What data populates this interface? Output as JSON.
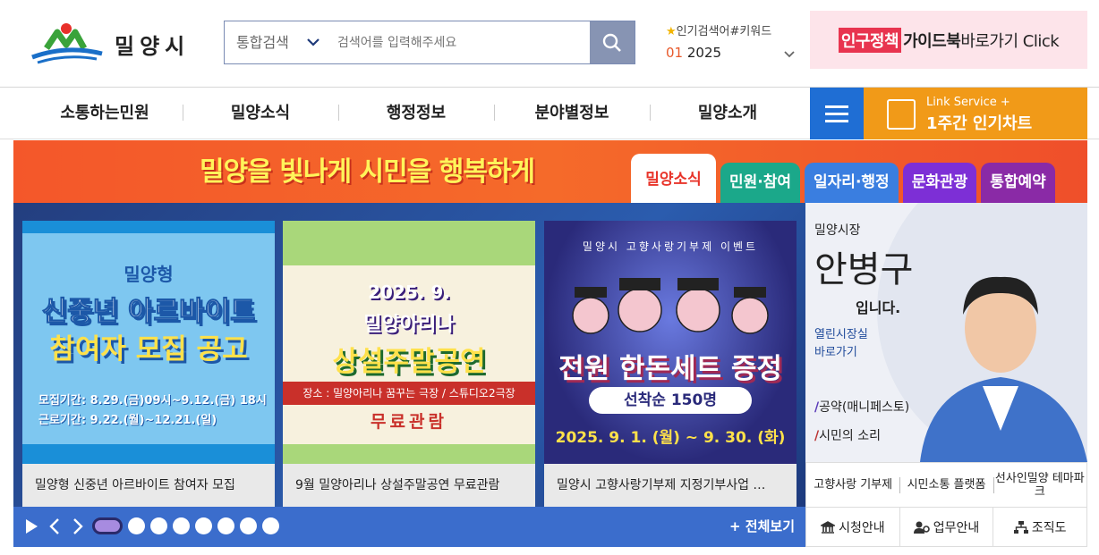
{
  "header": {
    "logo_text": "밀양시",
    "search": {
      "category": "통합검색",
      "placeholder": "검색어를 입력해주세요",
      "value": ""
    },
    "popular": {
      "title": "인기검색어#키워드",
      "rank": "01",
      "keyword": "2025"
    },
    "guide_banner": {
      "highlight": "인구정책",
      "bold": "가이드북",
      "rest": "바로가기 Click"
    }
  },
  "nav": {
    "items": [
      "소통하는민원",
      "밀양소식",
      "행정정보",
      "분야별정보",
      "밀양소개"
    ],
    "link_service": {
      "line1": "Link Service +",
      "line2": "1주간 인기차트"
    }
  },
  "band": {
    "slogan": "밀양을 빛나게 시민을 행복하게"
  },
  "tabs": [
    {
      "label": "밀양소식",
      "color": "#ffffff"
    },
    {
      "label": "민원·참여",
      "color": "#1ba88a"
    },
    {
      "label": "일자리·행정",
      "color": "#3a7ee0"
    },
    {
      "label": "문화관광",
      "color": "#7d2fd6"
    },
    {
      "label": "통합예약",
      "color": "#8a2aa6"
    }
  ],
  "cards": [
    {
      "caption": "밀양형 신중년 아르바이트 참여자 모집",
      "lines": [
        "밀양형",
        "신중년 아르바이트",
        "참여자 모집 공고",
        "모집기간: 8.29.(금)09시~9.12.(금) 18시",
        "근로기간: 9.22.(월)~12.21.(일)"
      ]
    },
    {
      "caption": "9월 밀양아리나 상설주말공연 무료관람",
      "lines": [
        "2025. 9.",
        "밀양아리나",
        "상설주말공연",
        "장소 : 밀양아리나 꿈꾸는 극장 / 스튜디오2극장",
        "무료관람"
      ]
    },
    {
      "caption": "밀양시 고향사랑기부제 지정기부사업 …",
      "lines": [
        "밀양시 고향사랑기부제 이벤트",
        "전원 한돈세트 증정",
        "선착순 150명",
        "2025. 9. 1. (월) ~ 9. 30. (화)"
      ]
    }
  ],
  "slider": {
    "dot_count": 8,
    "active_index": 0,
    "view_all": "+ 전체보기"
  },
  "mayor": {
    "role": "밀양시장",
    "name": "안병구",
    "suffix": "입니다.",
    "link1": "열린시장실",
    "link2": "바로가기",
    "pledge": "공약(매니페스토)",
    "voice": "시민의 소리"
  },
  "quick_links": [
    "고향사랑 기부제",
    "시민소통 플랫폼",
    "선사인밀양 테마파크"
  ],
  "services": [
    "시청안내",
    "업무안내",
    "조직도"
  ]
}
